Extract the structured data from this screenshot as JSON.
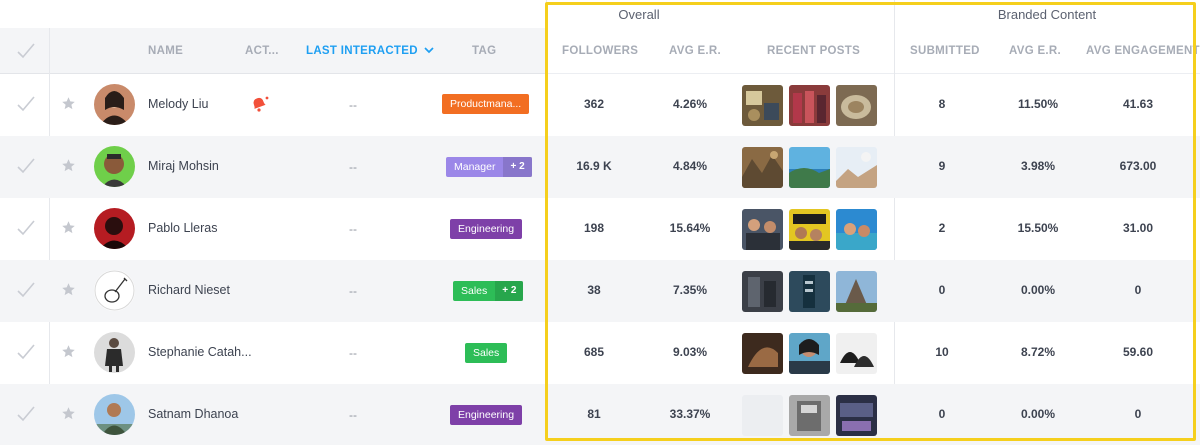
{
  "groups": {
    "overall": "Overall",
    "branded": "Branded Content"
  },
  "columns": {
    "name": "NAME",
    "activity": "ACT...",
    "last_interacted": "LAST INTERACTED",
    "tag": "TAG",
    "followers": "FOLLOWERS",
    "avg_er": "AVG E.R.",
    "recent_posts": "RECENT POSTS",
    "submitted": "SUBMITTED",
    "branded_avg_er": "AVG E.R.",
    "avg_engagement": "AVG ENGAGEMENT"
  },
  "colors": {
    "accent": "#1e9ff2",
    "highlight": "#f5cf1d",
    "orange_tag": "#f26e22",
    "lavender_tag": "#9b87e8",
    "purple_tag": "#7e40a8",
    "green_tag": "#2dbd57"
  },
  "rows": [
    {
      "name": "Melody Liu",
      "has_activity": true,
      "last_interacted": "--",
      "tag": "Productmana...",
      "tag_color": "#f26e22",
      "tag_extra": "",
      "followers": "362",
      "avg_er": "4.26%",
      "submitted": "8",
      "branded_avg_er": "11.50%",
      "avg_engagement": "41.63"
    },
    {
      "name": "Miraj Mohsin",
      "has_activity": false,
      "last_interacted": "--",
      "tag": "Manager",
      "tag_color": "#9b87e8",
      "tag_extra": "+ 2",
      "followers": "16.9 K",
      "avg_er": "4.84%",
      "submitted": "9",
      "branded_avg_er": "3.98%",
      "avg_engagement": "673.00"
    },
    {
      "name": "Pablo Lleras",
      "has_activity": false,
      "last_interacted": "--",
      "tag": "Engineering",
      "tag_color": "#7e40a8",
      "tag_extra": "",
      "followers": "198",
      "avg_er": "15.64%",
      "submitted": "2",
      "branded_avg_er": "15.50%",
      "avg_engagement": "31.00"
    },
    {
      "name": "Richard Nieset",
      "has_activity": false,
      "last_interacted": "--",
      "tag": "Sales",
      "tag_color": "#2dbd57",
      "tag_extra": "+ 2",
      "followers": "38",
      "avg_er": "7.35%",
      "submitted": "0",
      "branded_avg_er": "0.00%",
      "avg_engagement": "0"
    },
    {
      "name": "Stephanie Catah...",
      "has_activity": false,
      "last_interacted": "--",
      "tag": "Sales",
      "tag_color": "#2dbd57",
      "tag_extra": "",
      "followers": "685",
      "avg_er": "9.03%",
      "submitted": "10",
      "branded_avg_er": "8.72%",
      "avg_engagement": "59.60"
    },
    {
      "name": "Satnam Dhanoa",
      "has_activity": false,
      "last_interacted": "--",
      "tag": "Engineering",
      "tag_color": "#7e40a8",
      "tag_extra": "",
      "followers": "81",
      "avg_er": "33.37%",
      "submitted": "0",
      "branded_avg_er": "0.00%",
      "avg_engagement": "0"
    }
  ]
}
